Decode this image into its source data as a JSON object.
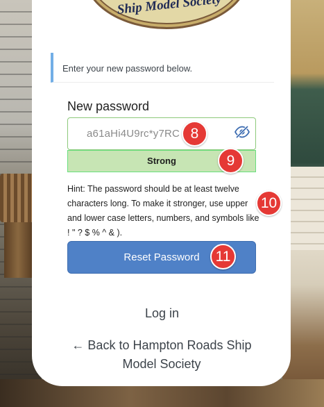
{
  "logo": {
    "text": "Ship Model Society"
  },
  "notice": "Enter your new password below.",
  "form": {
    "label": "New password",
    "password_value": "a61aHi4U9rc*y7RC",
    "strength": "Strong",
    "hint": "Hint: The password should be at least twelve characters long. To make it stronger, use upper and lower case letters, numbers, and symbols like ! \" ? $ % ^ & ).",
    "reset_button": "Reset Password"
  },
  "links": {
    "login": "Log in",
    "back": "← Back to Hampton Roads Ship Model Society"
  },
  "markers": [
    "8",
    "9",
    "10",
    "11"
  ],
  "colors": {
    "accent": "#72aee6",
    "button": "#4f81c7",
    "strong_bg": "#c7e5b4",
    "marker": "#e53935"
  },
  "icons": {
    "visibility": "eye-slash-icon"
  }
}
